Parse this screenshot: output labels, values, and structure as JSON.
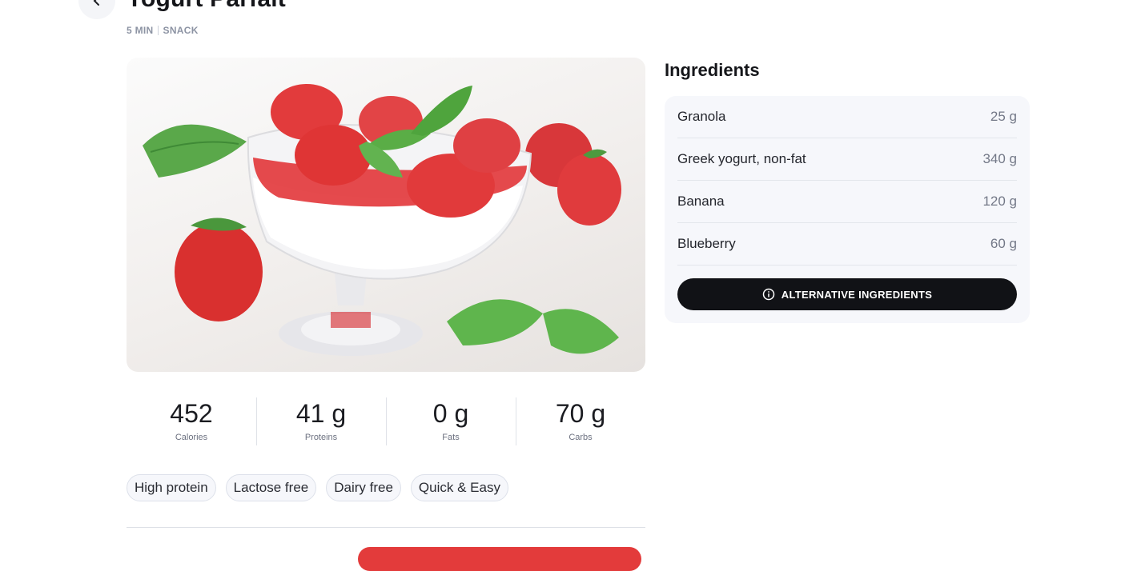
{
  "recipe": {
    "title": "Yogurt Parfait",
    "time": "5 MIN",
    "category": "SNACK"
  },
  "nutrition": [
    {
      "value": "452",
      "label": "Calories"
    },
    {
      "value": "41 g",
      "label": "Proteins"
    },
    {
      "value": "0 g",
      "label": "Fats"
    },
    {
      "value": "70 g",
      "label": "Carbs"
    }
  ],
  "tags": [
    "High protein",
    "Lactose free",
    "Dairy free",
    "Quick & Easy"
  ],
  "ingredients": {
    "heading": "Ingredients",
    "items": [
      {
        "name": "Granola",
        "qty": "25 g"
      },
      {
        "name": "Greek yogurt, non-fat",
        "qty": "340 g"
      },
      {
        "name": "Banana",
        "qty": "120 g"
      },
      {
        "name": "Blueberry",
        "qty": "60 g"
      }
    ],
    "alt_button_label": "ALTERNATIVE INGREDIENTS"
  },
  "icons": {
    "back": "chevron-left-icon",
    "info": "info-icon"
  },
  "colors": {
    "accent_dark": "#111216",
    "cta_red": "#e33b3b",
    "card_bg": "#f6f7fb"
  }
}
